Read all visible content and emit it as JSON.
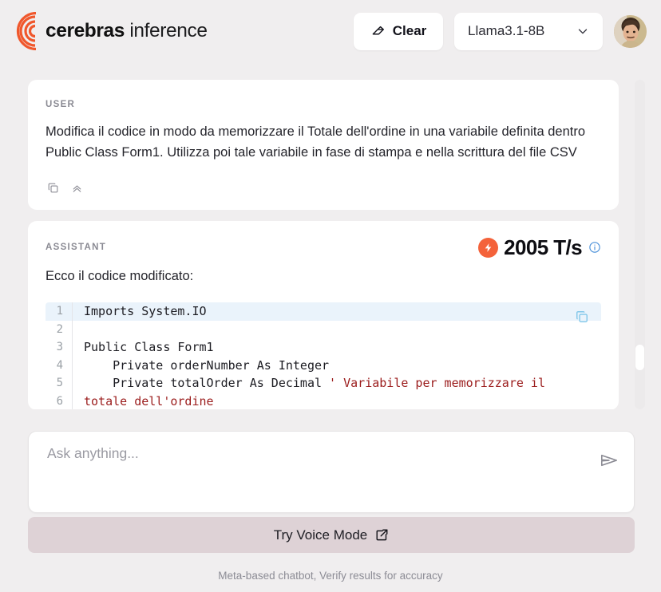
{
  "header": {
    "brand_bold": "cerebras",
    "brand_light": " inference",
    "clear_label": "Clear",
    "clear_icon": "eraser-icon",
    "model_value": "Llama3.1-8B",
    "model_caret_icon": "chevron-down-icon",
    "avatar_name": "user-avatar"
  },
  "user_message": {
    "role": "USER",
    "text": "Modifica il codice in modo da memorizzare il Totale dell'ordine in una variabile definita dentro Public Class Form1. Utilizza poi tale variabile in fase di stampa e nella scrittura del file CSV",
    "copy_icon": "copy-icon",
    "collapse_icon": "chevrons-up-icon"
  },
  "assistant_message": {
    "role": "ASSISTANT",
    "token_rate": "2005 T/s",
    "bolt_icon": "lightning-bolt-icon",
    "info_icon": "info-icon",
    "intro": "Ecco il codice modificato:",
    "code_copy_icon": "copy-icon",
    "code_lines": [
      {
        "n": "1",
        "highlight": true,
        "segments": [
          {
            "t": "Imports System.IO",
            "c": "kw"
          }
        ]
      },
      {
        "n": "2",
        "highlight": false,
        "segments": [
          {
            "t": "",
            "c": "kw"
          }
        ]
      },
      {
        "n": "3",
        "highlight": false,
        "segments": [
          {
            "t": "Public Class Form1",
            "c": "kw"
          }
        ]
      },
      {
        "n": "4",
        "highlight": false,
        "segments": [
          {
            "t": "    Private orderNumber As Integer",
            "c": "kw"
          }
        ]
      },
      {
        "n": "5",
        "highlight": false,
        "segments": [
          {
            "t": "    Private totalOrder As Decimal ",
            "c": "kw"
          },
          {
            "t": "' Variabile per memorizzare il",
            "c": "cmt"
          }
        ]
      },
      {
        "n": "6",
        "highlight": false,
        "segments": [
          {
            "t": "totale dell'ordine",
            "c": "cmt"
          }
        ]
      }
    ]
  },
  "composer": {
    "placeholder": "Ask anything...",
    "value": "",
    "send_icon": "send-icon"
  },
  "voice": {
    "label": "Try Voice Mode",
    "icon": "external-link-icon"
  },
  "footer": {
    "note": "Meta-based chatbot, Verify results for accuracy"
  },
  "colors": {
    "brand_orange": "#f4623a",
    "page_bg": "#f0eeef",
    "card_bg": "#ffffff",
    "voice_bg": "#ded2d6",
    "code_highlight": "#eaf3fb",
    "comment": "#9b1c1c",
    "info_blue": "#4a90d9"
  }
}
